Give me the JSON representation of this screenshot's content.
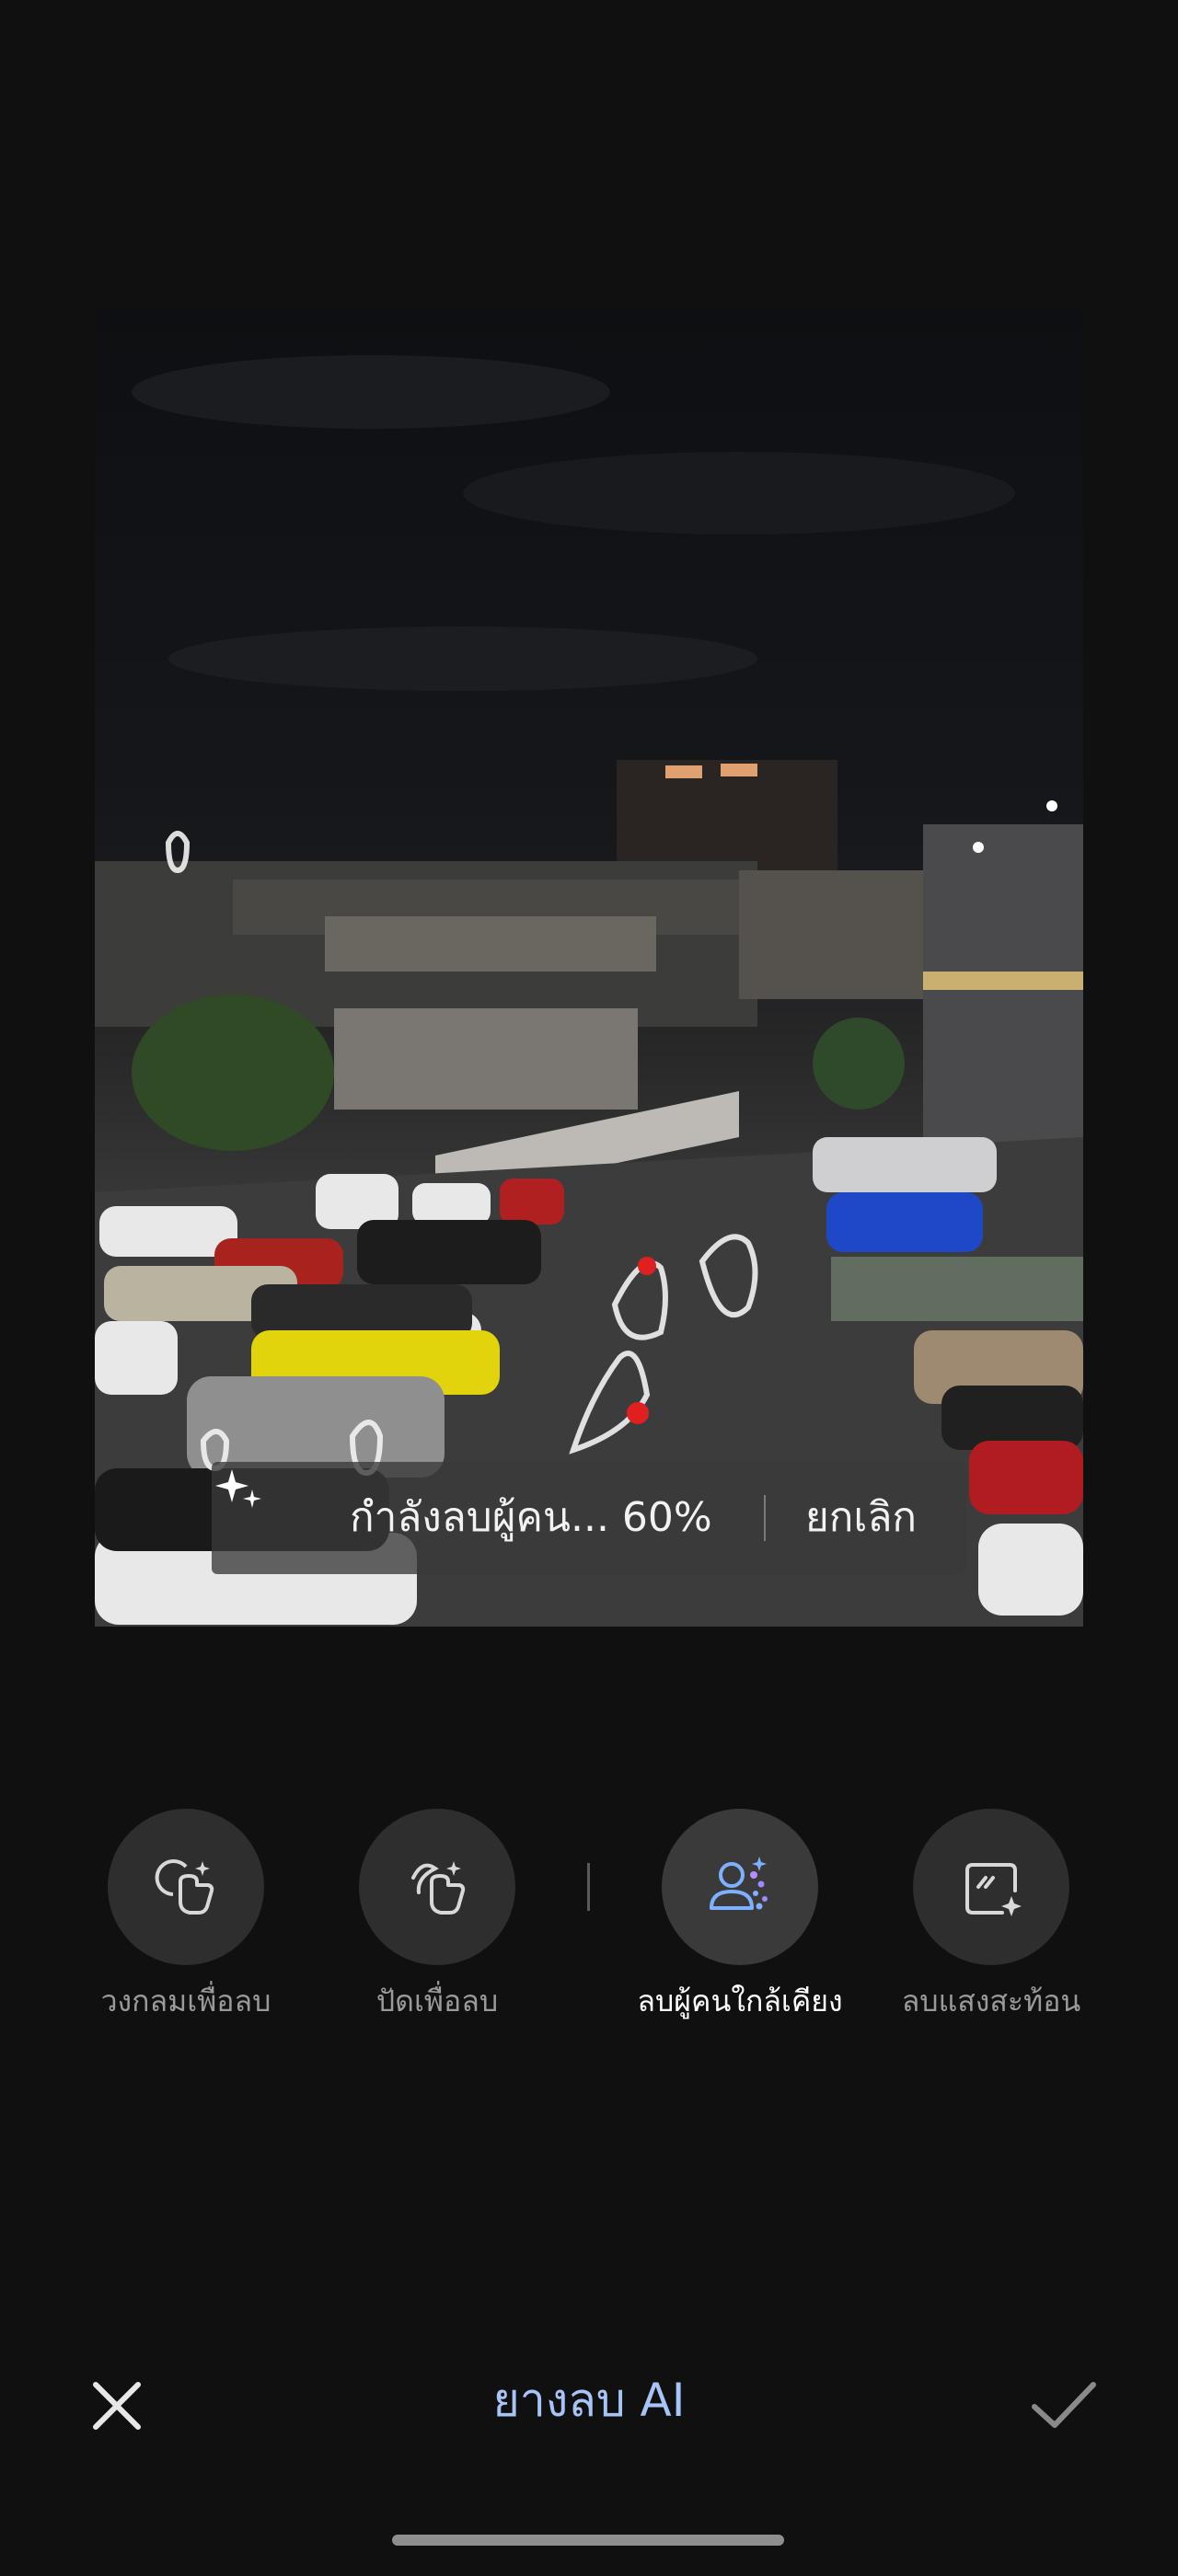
{
  "photo": {
    "description_icon": "night-parking-lot-photo"
  },
  "progress": {
    "text": "กำลังลบผู้คน... 60%",
    "cancel_label": "ยกเลิก",
    "value": 0.6
  },
  "tools": [
    {
      "label": "วงกลมเพื่อลบ",
      "icon": "circle-to-erase-icon",
      "active": false
    },
    {
      "label": "ปัดเพื่อลบ",
      "icon": "brush-to-erase-icon",
      "active": false
    },
    {
      "label": "ลบผู้คนใกล้เคียง",
      "icon": "remove-people-icon",
      "active": true
    },
    {
      "label": "ลบแสงสะท้อน",
      "icon": "remove-reflection-icon",
      "active": false
    }
  ],
  "footer": {
    "title": "ยางลบ AI",
    "close_icon": "close-icon",
    "confirm_icon": "checkmark-icon"
  },
  "colors": {
    "background": "#101010",
    "accent": "#a7c4f5",
    "active_icon": "#7fb0ff"
  }
}
